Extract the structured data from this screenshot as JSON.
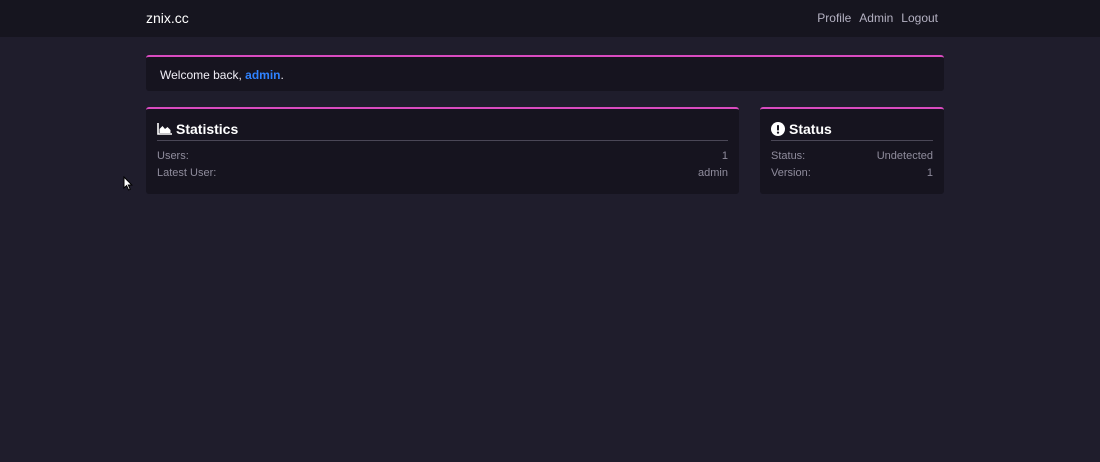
{
  "navbar": {
    "brand": "znix.cc",
    "links": [
      "Profile",
      "Admin",
      "Logout"
    ]
  },
  "welcome": {
    "prefix": "Welcome back, ",
    "username": "admin",
    "suffix": "."
  },
  "statistics": {
    "title": "Statistics",
    "icon": "area-chart-icon",
    "rows": [
      {
        "label": "Users:",
        "value": "1"
      },
      {
        "label": "Latest User:",
        "value": "admin"
      }
    ]
  },
  "status": {
    "title": "Status",
    "icon": "exclamation-circle-icon",
    "rows": [
      {
        "label": "Status:",
        "value": "Undetected"
      },
      {
        "label": "Version:",
        "value": "1"
      }
    ]
  },
  "colors": {
    "background": "#1f1d2c",
    "navbar": "#16151f",
    "card": "#16141f",
    "accent": "#d94bc0",
    "link": "#2f82ff"
  }
}
